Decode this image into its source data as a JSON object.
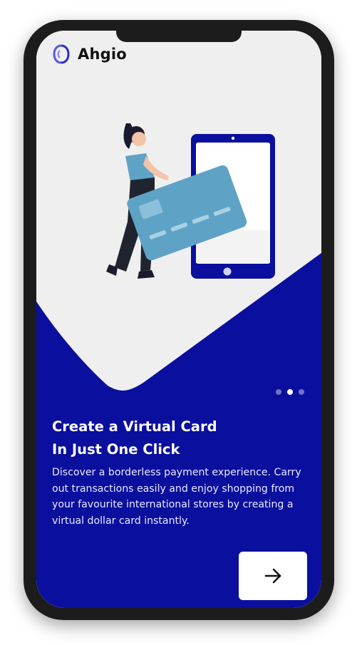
{
  "app": {
    "name": "Ahgio"
  },
  "onboarding": {
    "title_line1": "Create a Virtual Card",
    "title_line2": "In Just One Click",
    "description": "Discover a borderless payment experience. Carry out transactions easily and enjoy shopping from your favourite international stores by creating a virtual dollar card instantly.",
    "pagination": {
      "total": 3,
      "active": 2
    }
  },
  "next_button": {
    "icon": "arrow-right-icon"
  },
  "colors": {
    "primary": "#0a0f9e",
    "background": "#efefef",
    "card": "#5ea3c6",
    "text_on_primary": "#ffffff"
  }
}
